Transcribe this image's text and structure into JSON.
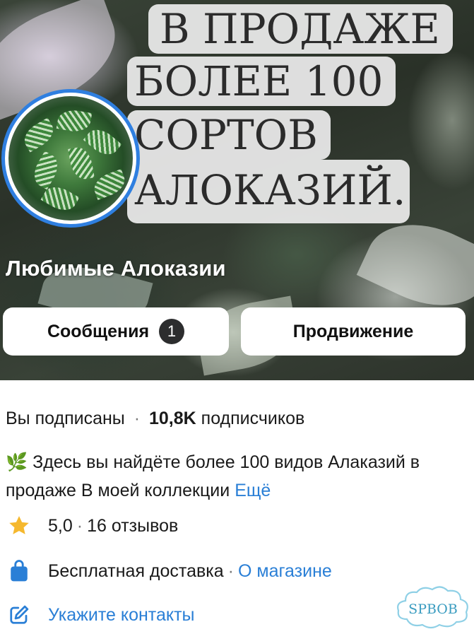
{
  "cover": {
    "banner_lines": [
      "В ПРОДАЖЕ",
      "БОЛЕЕ 100",
      "СОРТОВ",
      "АЛОКАЗИЙ."
    ]
  },
  "group": {
    "name": "Любимые Алоказии"
  },
  "actions": {
    "messages_label": "Сообщения",
    "messages_count": "1",
    "promote_label": "Продвижение"
  },
  "info": {
    "subscribed_status": "Вы подписаны",
    "subscribers_count": "10,8K",
    "subscribers_label": "подписчиков",
    "description_emoji": "🌿",
    "description": "Здесь вы найдёте более 100 видов Алаказий в продаже В моей коллекции",
    "more_link": "Ещё",
    "rating": "5,0",
    "reviews": "16 отзывов",
    "delivery": "Бесплатная доставка",
    "shop_link": "О магазине",
    "contacts_link": "Укажите контакты"
  },
  "watermark": {
    "text": "SPBOB"
  },
  "colors": {
    "accent": "#2a7fd6",
    "avatar_ring": "#2f7fe0",
    "star": "#f5b82e",
    "bag": "#2a7fd6",
    "badge_bg": "#2c2d2e"
  },
  "icons": {
    "rating": "star-icon",
    "delivery": "shopping-bag-icon",
    "contacts": "edit-icon"
  }
}
